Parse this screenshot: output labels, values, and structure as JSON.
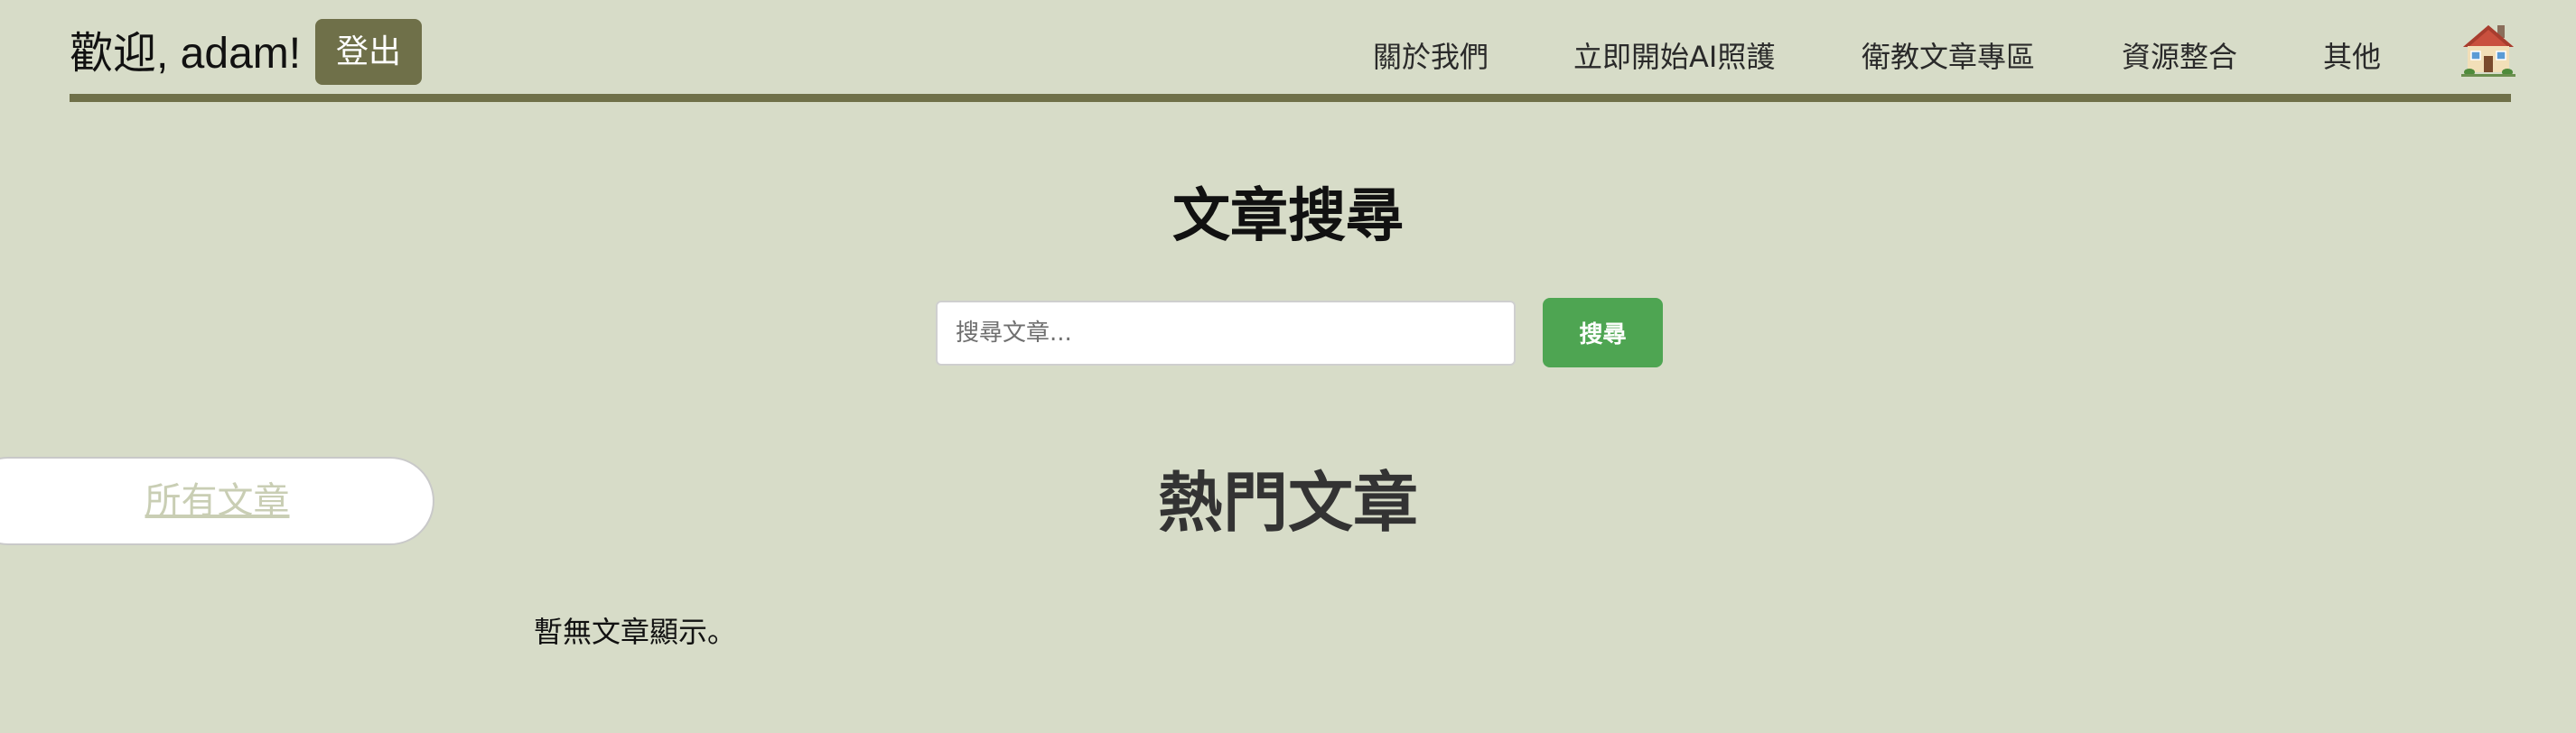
{
  "header": {
    "welcome": "歡迎, adam!",
    "logout_label": "登出",
    "nav": [
      "關於我們",
      "立即開始AI照護",
      "衛教文章專區",
      "資源整合",
      "其他"
    ],
    "home_icon": "house-icon"
  },
  "search": {
    "title": "文章搜尋",
    "placeholder": "搜尋文章...",
    "button_label": "搜尋"
  },
  "all_articles_label": "所有文章",
  "popular": {
    "title": "熱門文章",
    "empty_message": "暫無文章顯示。"
  },
  "colors": {
    "background": "#d7dcc8",
    "accent_olive": "#6f7049",
    "search_button": "#4ea552"
  }
}
